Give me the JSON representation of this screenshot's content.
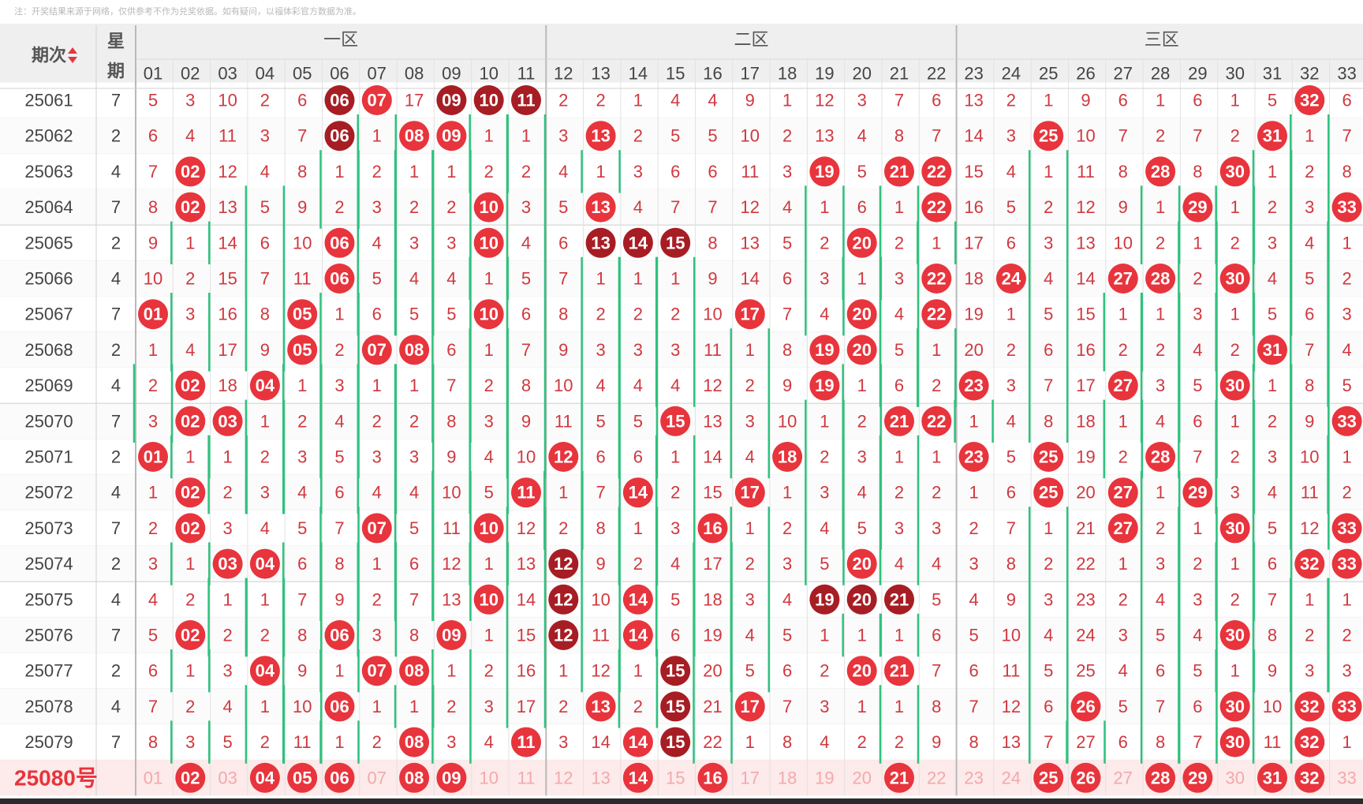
{
  "note": "注：开奖结果来源于网络，仅供参考不作为兑奖依据。如有疑问，以福体彩官方数据为准。",
  "header": {
    "issue_label": "期次",
    "weekday_label_top": "星",
    "weekday_label_bottom": "期",
    "zones": [
      "一区",
      "二区",
      "三区"
    ],
    "numbers": [
      "01",
      "02",
      "03",
      "04",
      "05",
      "06",
      "07",
      "08",
      "09",
      "10",
      "11",
      "12",
      "13",
      "14",
      "15",
      "16",
      "17",
      "18",
      "19",
      "20",
      "21",
      "22",
      "23",
      "24",
      "25",
      "26",
      "27",
      "28",
      "29",
      "30",
      "31",
      "32",
      "33"
    ]
  },
  "colors": {
    "red_ball": "#e8343c",
    "dark_ball": "#a71d24",
    "omission_text": "#d0383f",
    "trend_line": "#2ec27e",
    "header_bg": "#efefef",
    "forecast_bg": "#fdeaea"
  },
  "chart_data": {
    "type": "table",
    "rows": [
      {
        "issue": "25061",
        "weekday": "7",
        "values": [
          "5",
          "3",
          "10",
          "2",
          "6",
          "06",
          "07",
          "17",
          "09",
          "10",
          "11",
          "2",
          "2",
          "1",
          "4",
          "4",
          "9",
          "1",
          "12",
          "3",
          "7",
          "6",
          "13",
          "2",
          "1",
          "9",
          "6",
          "1",
          "6",
          "1",
          "5",
          "32",
          "6"
        ]
      },
      {
        "issue": "25062",
        "weekday": "2",
        "values": [
          "6",
          "4",
          "11",
          "3",
          "7",
          "06",
          "1",
          "08",
          "09",
          "1",
          "1",
          "3",
          "13",
          "2",
          "5",
          "5",
          "10",
          "2",
          "13",
          "4",
          "8",
          "7",
          "14",
          "3",
          "25",
          "10",
          "7",
          "2",
          "7",
          "2",
          "31",
          "1",
          "7"
        ]
      },
      {
        "issue": "25063",
        "weekday": "4",
        "values": [
          "7",
          "02",
          "12",
          "4",
          "8",
          "1",
          "2",
          "1",
          "1",
          "2",
          "2",
          "4",
          "1",
          "3",
          "6",
          "6",
          "11",
          "3",
          "19",
          "5",
          "21",
          "22",
          "15",
          "4",
          "1",
          "11",
          "8",
          "28",
          "8",
          "30",
          "1",
          "2",
          "8"
        ]
      },
      {
        "issue": "25064",
        "weekday": "7",
        "values": [
          "8",
          "02",
          "13",
          "5",
          "9",
          "2",
          "3",
          "2",
          "2",
          "10",
          "3",
          "5",
          "13",
          "4",
          "7",
          "7",
          "12",
          "4",
          "1",
          "6",
          "1",
          "22",
          "16",
          "5",
          "2",
          "12",
          "9",
          "1",
          "29",
          "1",
          "2",
          "3",
          "33"
        ]
      },
      {
        "issue": "25065",
        "weekday": "2",
        "values": [
          "9",
          "1",
          "14",
          "6",
          "10",
          "06",
          "4",
          "3",
          "3",
          "10",
          "4",
          "6",
          "13",
          "14",
          "15",
          "8",
          "13",
          "5",
          "2",
          "20",
          "2",
          "1",
          "17",
          "6",
          "3",
          "13",
          "10",
          "2",
          "1",
          "2",
          "3",
          "4",
          "1"
        ]
      },
      {
        "issue": "25066",
        "weekday": "4",
        "values": [
          "10",
          "2",
          "15",
          "7",
          "11",
          "06",
          "5",
          "4",
          "4",
          "1",
          "5",
          "7",
          "1",
          "1",
          "1",
          "9",
          "14",
          "6",
          "3",
          "1",
          "3",
          "22",
          "18",
          "24",
          "4",
          "14",
          "27",
          "28",
          "2",
          "30",
          "4",
          "5",
          "2"
        ]
      },
      {
        "issue": "25067",
        "weekday": "7",
        "values": [
          "01",
          "3",
          "16",
          "8",
          "05",
          "1",
          "6",
          "5",
          "5",
          "10",
          "6",
          "8",
          "2",
          "2",
          "2",
          "10",
          "17",
          "7",
          "4",
          "20",
          "4",
          "22",
          "19",
          "1",
          "5",
          "15",
          "1",
          "1",
          "3",
          "1",
          "5",
          "6",
          "3"
        ]
      },
      {
        "issue": "25068",
        "weekday": "2",
        "values": [
          "1",
          "4",
          "17",
          "9",
          "05",
          "2",
          "07",
          "08",
          "6",
          "1",
          "7",
          "9",
          "3",
          "3",
          "3",
          "11",
          "1",
          "8",
          "19",
          "20",
          "5",
          "1",
          "20",
          "2",
          "6",
          "16",
          "2",
          "2",
          "4",
          "2",
          "31",
          "7",
          "4"
        ]
      },
      {
        "issue": "25069",
        "weekday": "4",
        "values": [
          "2",
          "02",
          "18",
          "04",
          "1",
          "3",
          "1",
          "1",
          "7",
          "2",
          "8",
          "10",
          "4",
          "4",
          "4",
          "12",
          "2",
          "9",
          "19",
          "1",
          "6",
          "2",
          "23",
          "3",
          "7",
          "17",
          "27",
          "3",
          "5",
          "30",
          "1",
          "8",
          "5"
        ]
      },
      {
        "issue": "25070",
        "weekday": "7",
        "values": [
          "3",
          "02",
          "03",
          "1",
          "2",
          "4",
          "2",
          "2",
          "8",
          "3",
          "9",
          "11",
          "5",
          "5",
          "15",
          "13",
          "3",
          "10",
          "1",
          "2",
          "21",
          "22",
          "1",
          "4",
          "8",
          "18",
          "1",
          "4",
          "6",
          "1",
          "2",
          "9",
          "33"
        ]
      },
      {
        "issue": "25071",
        "weekday": "2",
        "values": [
          "01",
          "1",
          "1",
          "2",
          "3",
          "5",
          "3",
          "3",
          "9",
          "4",
          "10",
          "12",
          "6",
          "6",
          "1",
          "14",
          "4",
          "18",
          "2",
          "3",
          "1",
          "1",
          "23",
          "5",
          "25",
          "19",
          "2",
          "28",
          "7",
          "2",
          "3",
          "10",
          "1"
        ]
      },
      {
        "issue": "25072",
        "weekday": "4",
        "values": [
          "1",
          "02",
          "2",
          "3",
          "4",
          "6",
          "4",
          "4",
          "10",
          "5",
          "11",
          "1",
          "7",
          "14",
          "2",
          "15",
          "17",
          "1",
          "3",
          "4",
          "2",
          "2",
          "1",
          "6",
          "25",
          "20",
          "27",
          "1",
          "29",
          "3",
          "4",
          "11",
          "2"
        ]
      },
      {
        "issue": "25073",
        "weekday": "7",
        "values": [
          "2",
          "02",
          "3",
          "4",
          "5",
          "7",
          "07",
          "5",
          "11",
          "10",
          "12",
          "2",
          "8",
          "1",
          "3",
          "16",
          "1",
          "2",
          "4",
          "5",
          "3",
          "3",
          "2",
          "7",
          "1",
          "21",
          "27",
          "2",
          "1",
          "30",
          "5",
          "12",
          "33"
        ]
      },
      {
        "issue": "25074",
        "weekday": "2",
        "values": [
          "3",
          "1",
          "03",
          "04",
          "6",
          "8",
          "1",
          "6",
          "12",
          "1",
          "13",
          "12",
          "9",
          "2",
          "4",
          "17",
          "2",
          "3",
          "5",
          "20",
          "4",
          "4",
          "3",
          "8",
          "2",
          "22",
          "1",
          "3",
          "2",
          "1",
          "6",
          "32",
          "33"
        ]
      },
      {
        "issue": "25075",
        "weekday": "4",
        "values": [
          "4",
          "2",
          "1",
          "1",
          "7",
          "9",
          "2",
          "7",
          "13",
          "10",
          "14",
          "12",
          "10",
          "14",
          "5",
          "18",
          "3",
          "4",
          "19",
          "20",
          "21",
          "5",
          "4",
          "9",
          "3",
          "23",
          "2",
          "4",
          "3",
          "2",
          "7",
          "1",
          "1"
        ]
      },
      {
        "issue": "25076",
        "weekday": "7",
        "values": [
          "5",
          "02",
          "2",
          "2",
          "8",
          "06",
          "3",
          "8",
          "09",
          "1",
          "15",
          "12",
          "11",
          "14",
          "6",
          "19",
          "4",
          "5",
          "1",
          "1",
          "1",
          "6",
          "5",
          "10",
          "4",
          "24",
          "3",
          "5",
          "4",
          "30",
          "8",
          "2",
          "2"
        ]
      },
      {
        "issue": "25077",
        "weekday": "2",
        "values": [
          "6",
          "1",
          "3",
          "04",
          "9",
          "1",
          "07",
          "08",
          "1",
          "2",
          "16",
          "1",
          "12",
          "1",
          "15",
          "20",
          "5",
          "6",
          "2",
          "20",
          "21",
          "7",
          "6",
          "11",
          "5",
          "25",
          "4",
          "6",
          "5",
          "1",
          "9",
          "3",
          "3"
        ]
      },
      {
        "issue": "25078",
        "weekday": "4",
        "values": [
          "7",
          "2",
          "4",
          "1",
          "10",
          "06",
          "1",
          "1",
          "2",
          "3",
          "17",
          "2",
          "13",
          "2",
          "15",
          "21",
          "17",
          "7",
          "3",
          "1",
          "1",
          "8",
          "7",
          "12",
          "6",
          "26",
          "5",
          "7",
          "6",
          "30",
          "10",
          "32",
          "33"
        ]
      },
      {
        "issue": "25079",
        "weekday": "7",
        "values": [
          "8",
          "3",
          "5",
          "2",
          "11",
          "1",
          "2",
          "08",
          "3",
          "4",
          "11",
          "3",
          "14",
          "14",
          "15",
          "22",
          "1",
          "8",
          "4",
          "2",
          "2",
          "9",
          "8",
          "13",
          "7",
          "27",
          "6",
          "8",
          "7",
          "30",
          "11",
          "32",
          "1"
        ]
      }
    ],
    "dark_hits": [
      [
        5,
        8,
        9,
        10
      ],
      [
        5
      ],
      [],
      [],
      [
        12,
        13,
        14
      ],
      [],
      [],
      [],
      [],
      [],
      [],
      [],
      [],
      [
        11
      ],
      [
        11,
        18,
        19,
        20
      ],
      [
        11
      ],
      [
        14
      ],
      [
        14
      ],
      [
        14
      ]
    ],
    "forecast": {
      "issue": "25080号",
      "values": [
        "01",
        "02",
        "03",
        "04",
        "05",
        "06",
        "07",
        "08",
        "09",
        "10",
        "11",
        "12",
        "13",
        "14",
        "15",
        "16",
        "17",
        "18",
        "19",
        "20",
        "21",
        "22",
        "23",
        "24",
        "25",
        "26",
        "27",
        "28",
        "29",
        "30",
        "31",
        "32",
        "33"
      ],
      "selected": [
        "02",
        "04",
        "05",
        "06",
        "08",
        "09",
        "14",
        "16",
        "21",
        "25",
        "26",
        "28",
        "29",
        "31",
        "32"
      ]
    }
  }
}
